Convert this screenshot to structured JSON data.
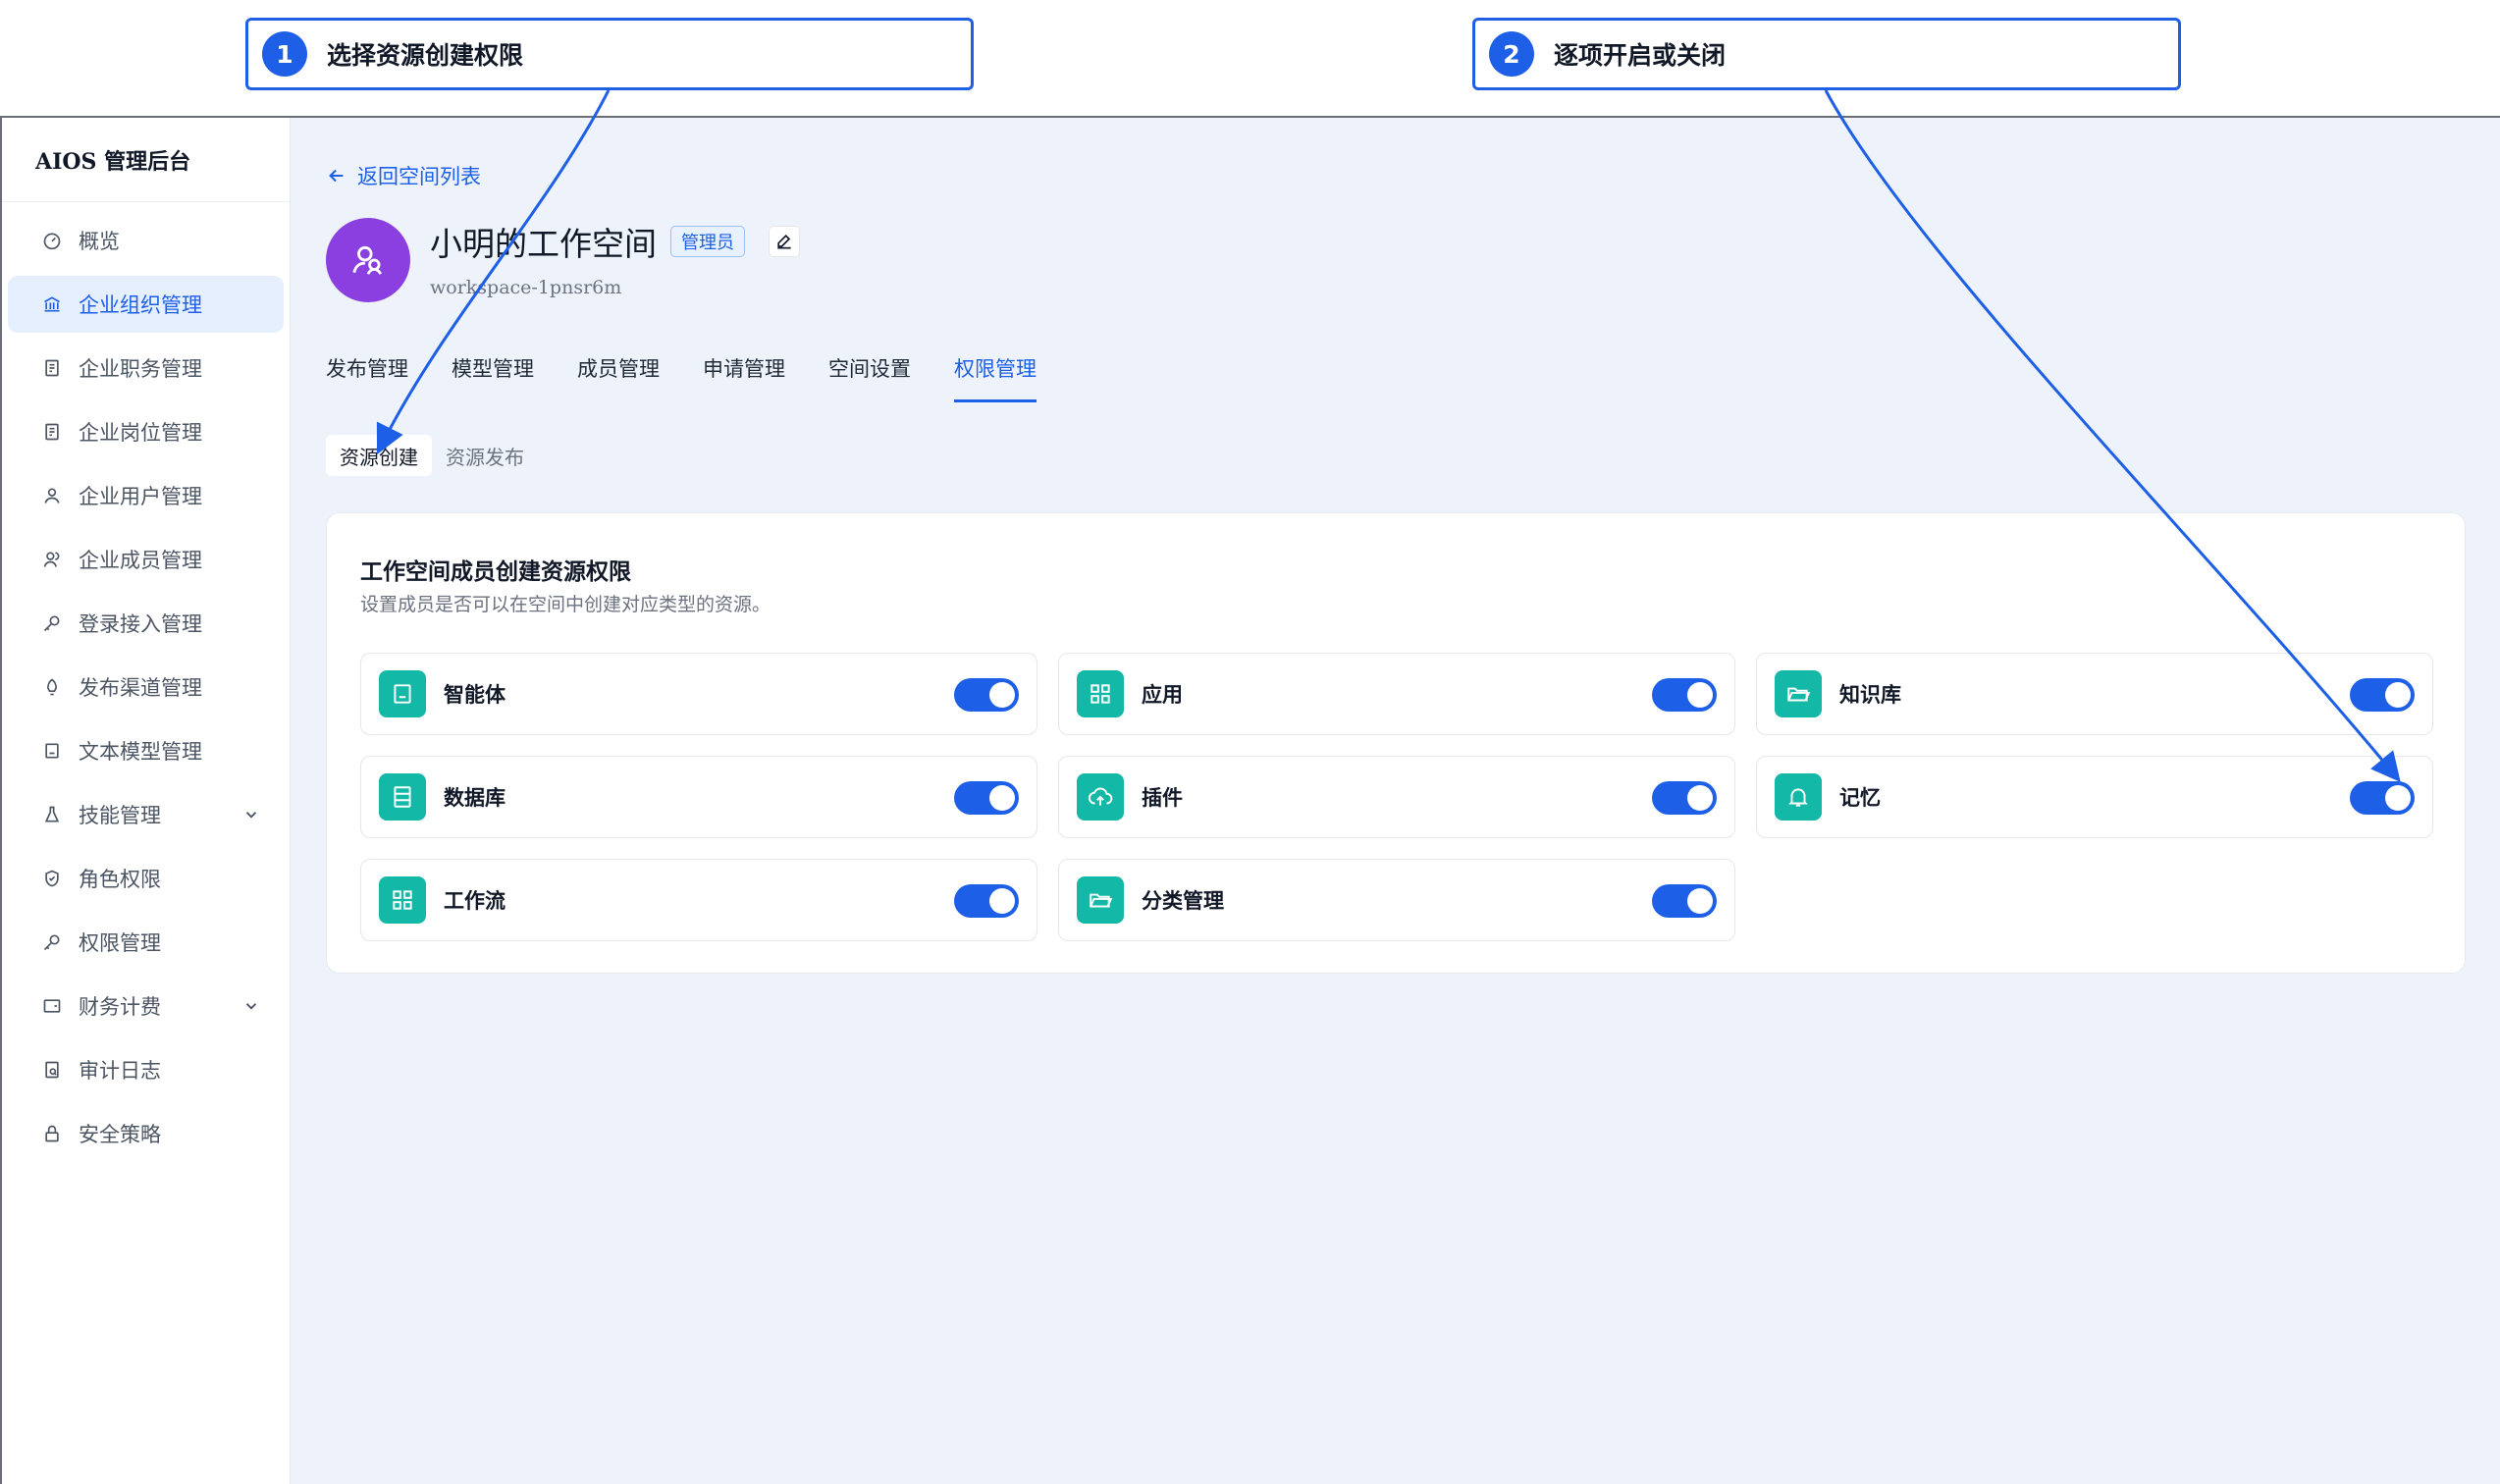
{
  "callouts": [
    {
      "number": "1",
      "text": "选择资源创建权限"
    },
    {
      "number": "2",
      "text": "逐项开启或关闭"
    }
  ],
  "app": {
    "brand": "AIOS 管理后台"
  },
  "sidebar": {
    "items": [
      {
        "label": "概览",
        "icon": "dashboard-icon"
      },
      {
        "label": "企业组织管理",
        "icon": "bank-icon",
        "active": true
      },
      {
        "label": "企业职务管理",
        "icon": "document-icon"
      },
      {
        "label": "企业岗位管理",
        "icon": "document-icon"
      },
      {
        "label": "企业用户管理",
        "icon": "user-icon"
      },
      {
        "label": "企业成员管理",
        "icon": "users-icon"
      },
      {
        "label": "登录接入管理",
        "icon": "key-icon"
      },
      {
        "label": "发布渠道管理",
        "icon": "rocket-icon"
      },
      {
        "label": "文本模型管理",
        "icon": "bot-icon"
      },
      {
        "label": "技能管理",
        "icon": "flask-icon",
        "expandable": true
      },
      {
        "label": "角色权限",
        "icon": "shield-icon"
      },
      {
        "label": "权限管理",
        "icon": "key-icon"
      },
      {
        "label": "财务计费",
        "icon": "wallet-icon",
        "expandable": true
      },
      {
        "label": "审计日志",
        "icon": "log-icon"
      },
      {
        "label": "安全策略",
        "icon": "lock-icon"
      }
    ]
  },
  "header": {
    "back_label": "返回空间列表",
    "workspace_name": "小明的工作空间",
    "role_badge": "管理员",
    "workspace_id": "workspace-1pnsr6m"
  },
  "tabs": [
    {
      "label": "发布管理"
    },
    {
      "label": "模型管理"
    },
    {
      "label": "成员管理"
    },
    {
      "label": "申请管理"
    },
    {
      "label": "空间设置"
    },
    {
      "label": "权限管理",
      "active": true
    }
  ],
  "subtabs": [
    {
      "label": "资源创建",
      "active": true
    },
    {
      "label": "资源发布"
    }
  ],
  "permissions": {
    "title": "工作空间成员创建资源权限",
    "description": "设置成员是否可以在空间中创建对应类型的资源。",
    "items": [
      {
        "label": "智能体",
        "icon": "bot-icon",
        "enabled": true
      },
      {
        "label": "应用",
        "icon": "grid-icon",
        "enabled": true
      },
      {
        "label": "知识库",
        "icon": "folder-open-icon",
        "enabled": true
      },
      {
        "label": "数据库",
        "icon": "database-icon",
        "enabled": true
      },
      {
        "label": "插件",
        "icon": "cloud-upload-icon",
        "enabled": true
      },
      {
        "label": "记忆",
        "icon": "bell-icon",
        "enabled": true
      },
      {
        "label": "工作流",
        "icon": "grid-icon",
        "enabled": true
      },
      {
        "label": "分类管理",
        "icon": "folder-open-icon",
        "enabled": true
      }
    ]
  },
  "colors": {
    "accent": "#1d5fe6",
    "avatar": "#8b3fe0",
    "icon_bg": "#14b8a6",
    "page_bg": "#eef3fb"
  }
}
